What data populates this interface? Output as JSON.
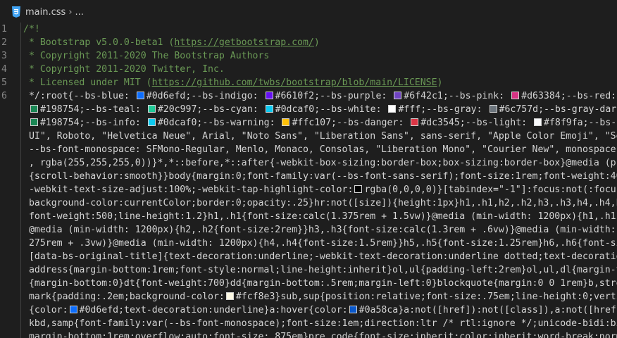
{
  "breadcrumb": {
    "file": "main.css",
    "separator": "›",
    "more": "..."
  },
  "colors": {
    "comment": "#6a9955",
    "text": "#d4d4d4",
    "background": "#1e1e1e",
    "line_number": "#858585"
  },
  "editor": {
    "lines": [
      {
        "n": "1",
        "segs": [
          {
            "t": "/*!",
            "c": "cm"
          }
        ]
      },
      {
        "n": "2",
        "segs": [
          {
            "t": " * Bootstrap v5.0.0-beta1 (",
            "c": "cm"
          },
          {
            "t": "https://getbootstrap.com/",
            "c": "lk"
          },
          {
            "t": ")",
            "c": "cm"
          }
        ]
      },
      {
        "n": "3",
        "segs": [
          {
            "t": " * Copyright 2011-2020 The Bootstrap Authors",
            "c": "cm"
          }
        ]
      },
      {
        "n": "4",
        "segs": [
          {
            "t": " * Copyright 2011-2020 Twitter, Inc.",
            "c": "cm"
          }
        ]
      },
      {
        "n": "5",
        "segs": [
          {
            "t": " * Licensed under MIT (",
            "c": "cm"
          },
          {
            "t": "https://github.com/twbs/bootstrap/blob/main/LICENSE",
            "c": "lk"
          },
          {
            "t": ")",
            "c": "cm"
          }
        ]
      },
      {
        "n": "6",
        "segs": [
          {
            "t": " */:root{--bs-blue: "
          },
          {
            "sw": "#0d6efd"
          },
          {
            "t": "#0d6efd;--bs-indigo: "
          },
          {
            "sw": "#6610f2"
          },
          {
            "t": "#6610f2;--bs-purple: "
          },
          {
            "sw": "#6f42c1"
          },
          {
            "t": "#6f42c1;--bs-pink: "
          },
          {
            "sw": "#d63384"
          },
          {
            "t": "#d63384;--bs-red: "
          },
          {
            "sw": "#dc3545"
          }
        ]
      },
      {
        "n": "",
        "segs": [
          {
            "t": " "
          },
          {
            "sw": "#198754"
          },
          {
            "t": "#198754;--bs-teal: "
          },
          {
            "sw": "#20c997"
          },
          {
            "t": "#20c997;--bs-cyan: "
          },
          {
            "sw": "#0dcaf0"
          },
          {
            "t": "#0dcaf0;--bs-white: "
          },
          {
            "sw": "#ffffff"
          },
          {
            "t": "#fff;--bs-gray: "
          },
          {
            "sw": "#6c757d"
          },
          {
            "t": "#6c757d;--bs-gray-dark: "
          },
          {
            "sw": "#343a40"
          }
        ]
      },
      {
        "n": "",
        "segs": [
          {
            "t": " "
          },
          {
            "sw": "#198754"
          },
          {
            "t": "#198754;--bs-info: "
          },
          {
            "sw": "#0dcaf0"
          },
          {
            "t": "#0dcaf0;--bs-warning: "
          },
          {
            "sw": "#ffc107"
          },
          {
            "t": "#ffc107;--bs-danger: "
          },
          {
            "sw": "#dc3545"
          },
          {
            "t": "#dc3545;--bs-light: "
          },
          {
            "sw": "#f8f9fa"
          },
          {
            "t": "#f8f9fa;--bs-dark"
          }
        ]
      },
      {
        "n": "",
        "segs": [
          {
            "t": " UI\", Roboto, \"Helvetica Neue\", Arial, \"Noto Sans\", \"Liberation Sans\", sans-serif, \"Apple Color Emoji\", \"Segoe"
          }
        ]
      },
      {
        "n": "",
        "segs": [
          {
            "t": " --bs-font-monospace: SFMono-Regular, Menlo, Monaco, Consolas, \"Liberation Mono\", \"Courier New\", monospace;--b"
          }
        ]
      },
      {
        "n": "",
        "segs": [
          {
            "t": " , rgba(255,255,255,0))}*,*::before,*::after{-webkit-box-sizing:border-box;box-sizing:border-box}@media (prefe"
          }
        ]
      },
      {
        "n": "",
        "segs": [
          {
            "t": " {scroll-behavior:smooth}}body{margin:0;font-family:var(--bs-font-sans-serif);font-size:1rem;font-weight:400;l"
          }
        ]
      },
      {
        "n": "",
        "segs": [
          {
            "t": " -webkit-text-size-adjust:100%;-webkit-tap-highlight-color:"
          },
          {
            "sw": "#000000"
          },
          {
            "t": "rgba(0,0,0,0)}[tabindex=\"-1\"]:focus:not(:focus-vi"
          }
        ]
      },
      {
        "n": "",
        "segs": [
          {
            "t": " background-color:currentColor;border:0;opacity:.25}hr:not([size]){height:1px}h1,.h1,h2,.h2,h3,.h3,h4,.h4,h5,."
          }
        ]
      },
      {
        "n": "",
        "segs": [
          {
            "t": " font-weight:500;line-height:1.2}h1,.h1{font-size:calc(1.375rem + 1.5vw)}@media (min-width: 1200px){h1,.h1{fon"
          }
        ]
      },
      {
        "n": "",
        "segs": [
          {
            "t": " @media (min-width: 1200px){h2,.h2{font-size:2rem}}h3,.h3{font-size:calc(1.3rem + .6vw)}@media (min-width: 120"
          }
        ]
      },
      {
        "n": "",
        "segs": [
          {
            "t": " 275rem + .3vw)}@media (min-width: 1200px){h4,.h4{font-size:1.5rem}}h5,.h5{font-size:1.25rem}h6,.h6{font-size:"
          }
        ]
      },
      {
        "n": "",
        "segs": [
          {
            "t": " [data-bs-original-title]{text-decoration:underline;-webkit-text-decoration:underline dotted;text-decoration:u"
          }
        ]
      },
      {
        "n": "",
        "segs": [
          {
            "t": " address{margin-bottom:1rem;font-style:normal;line-height:inherit}ol,ul{padding-left:2rem}ol,ul,dl{margin-top:"
          }
        ]
      },
      {
        "n": "",
        "segs": [
          {
            "t": " {margin-bottom:0}dt{font-weight:700}dd{margin-bottom:.5rem;margin-left:0}blockquote{margin:0 0 1rem}b,strong{"
          }
        ]
      },
      {
        "n": "",
        "segs": [
          {
            "t": " mark{padding:.2em;background-color:"
          },
          {
            "sw": "#fcf8e3"
          },
          {
            "t": "#fcf8e3}sub,sup{position:relative;font-size:.75em;line-height:0;vertical"
          }
        ]
      },
      {
        "n": "",
        "segs": [
          {
            "t": " {color:"
          },
          {
            "sw": "#0d6efd"
          },
          {
            "t": "#0d6efd;text-decoration:underline}a:hover{color:"
          },
          {
            "sw": "#0a58ca"
          },
          {
            "t": "#0a58ca}a:not([href]):not([class]),a:not([href]):"
          }
        ]
      },
      {
        "n": "",
        "segs": [
          {
            "t": " kbd,samp{font-family:var(--bs-font-monospace);font-size:1em;direction:ltr /* rtl:ignore */;unicode-bidi:bidi-"
          }
        ]
      },
      {
        "n": "",
        "segs": [
          {
            "t": " margin-bottom:1rem;overflow:auto;font-size:.875em}pre code{font-size:inherit;color:inherit;word-break:normal}"
          }
        ]
      }
    ]
  }
}
